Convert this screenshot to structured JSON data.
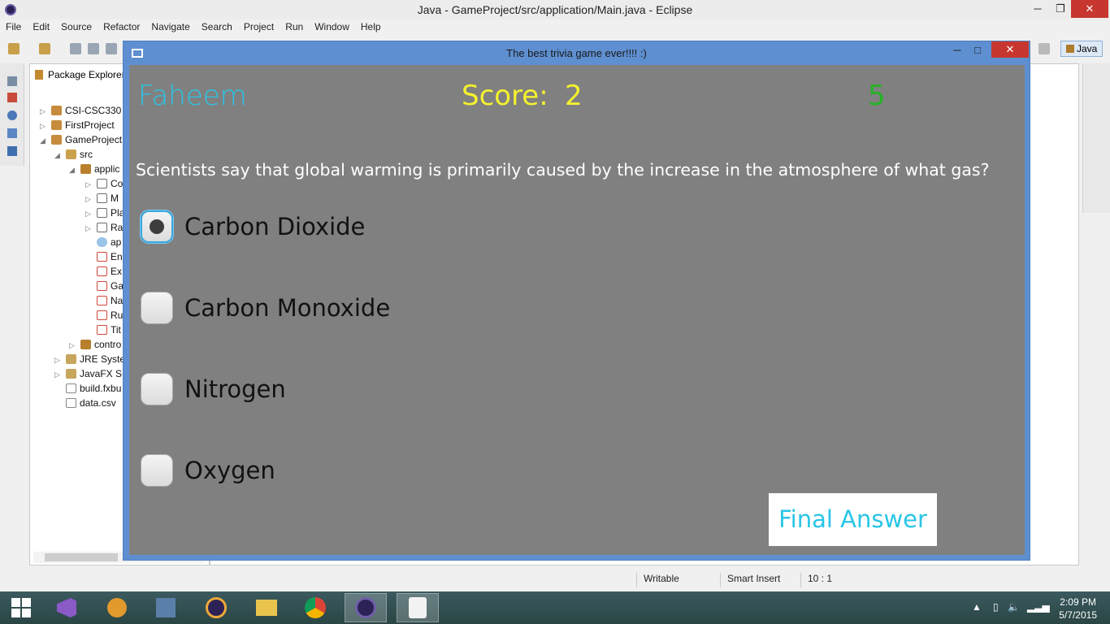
{
  "eclipse": {
    "title": "Java - GameProject/src/application/Main.java - Eclipse",
    "menu": [
      "File",
      "Edit",
      "Source",
      "Refactor",
      "Navigate",
      "Search",
      "Project",
      "Run",
      "Window",
      "Help"
    ],
    "perspective": "Java"
  },
  "package_explorer": {
    "tab_label": "Package Explorer",
    "tree": [
      {
        "label": "CSI-CSC330",
        "icon": "project-icon"
      },
      {
        "label": "FirstProject",
        "icon": "project-icon"
      },
      {
        "label": "GameProject",
        "icon": "project-icon"
      },
      {
        "label": "src",
        "icon": "source-folder-icon"
      },
      {
        "label": "applic",
        "icon": "package-icon"
      },
      {
        "label": "Co",
        "icon": "java-file-icon"
      },
      {
        "label": "M",
        "icon": "java-file-icon"
      },
      {
        "label": "Pla",
        "icon": "java-file-icon"
      },
      {
        "label": "Ra",
        "icon": "java-file-icon"
      },
      {
        "label": "ap",
        "icon": "css-file-icon"
      },
      {
        "label": "En",
        "icon": "fxml-file-icon"
      },
      {
        "label": "Ex",
        "icon": "fxml-file-icon"
      },
      {
        "label": "Ga",
        "icon": "fxml-file-icon"
      },
      {
        "label": "Na",
        "icon": "fxml-file-icon"
      },
      {
        "label": "Ru",
        "icon": "fxml-file-icon"
      },
      {
        "label": "Tit",
        "icon": "fxml-file-icon"
      },
      {
        "label": "contro",
        "icon": "package-icon"
      },
      {
        "label": "JRE Syster",
        "icon": "library-icon"
      },
      {
        "label": "JavaFX SD",
        "icon": "library-icon"
      },
      {
        "label": "build.fxbu",
        "icon": "file-icon"
      },
      {
        "label": "data.csv",
        "icon": "file-icon"
      }
    ]
  },
  "statusbar": {
    "writable": "Writable",
    "insert_mode": "Smart Insert",
    "position": "10 : 1"
  },
  "taskbar": {
    "time": "2:09 PM",
    "date": "5/7/2015"
  },
  "dialog": {
    "title": "The best trivia game ever!!!!  :)",
    "player_name": "Faheem",
    "score_label": "Score:",
    "score_value": "2",
    "timer_value": "5",
    "question": "Scientists say that global warming is primarily caused by the increase in the atmosphere of what gas?",
    "answers": [
      {
        "label": "Carbon Dioxide",
        "selected": true
      },
      {
        "label": "Carbon Monoxide",
        "selected": false
      },
      {
        "label": "Nitrogen",
        "selected": false
      },
      {
        "label": "Oxygen",
        "selected": false
      }
    ],
    "final_button": "Final Answer"
  },
  "colors": {
    "player_name": "#29c5e6",
    "score": "#f4f22e",
    "timer": "#23b324",
    "dialog_frame": "#5e8fd0",
    "dialog_body": "#808080"
  }
}
